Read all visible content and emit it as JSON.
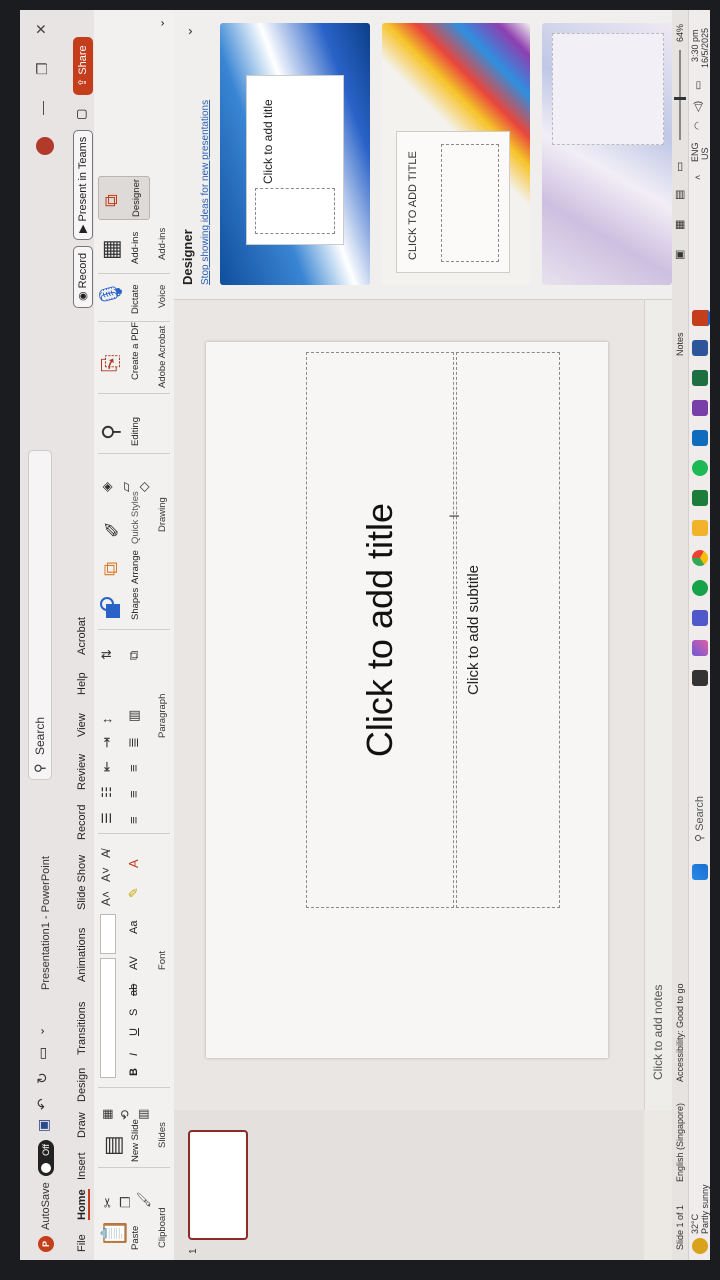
{
  "titlebar": {
    "autosave_label": "AutoSave",
    "autosave_state": "Off",
    "doc_title": "Presentation1 - PowerPoint",
    "search_label": "Search"
  },
  "tabs": [
    "File",
    "Home",
    "Insert",
    "Draw",
    "Design",
    "Transitions",
    "Animations",
    "Slide Show",
    "Record",
    "Review",
    "View",
    "Help",
    "Acrobat"
  ],
  "tab_actions": {
    "record": "Record",
    "present": "Present in Teams",
    "share": "Share"
  },
  "ribbon": {
    "groups": {
      "clipboard": "Clipboard",
      "slides": "Slides",
      "font": "Font",
      "paragraph": "Paragraph",
      "drawing": "Drawing",
      "adobe": "Adobe Acrobat",
      "voice": "Voice",
      "addins": "Add-ins"
    },
    "paste": "Paste",
    "new_slide": "New Slide",
    "shapes": "Shapes",
    "arrange": "Arrange",
    "quick_styles": "Quick Styles",
    "editing": "Editing",
    "create_pdf": "Create a PDF",
    "dictate": "Dictate",
    "addins_btn": "Add-ins",
    "designer_btn": "Designer",
    "font_buttons": [
      "B",
      "I",
      "U",
      "S",
      "ab",
      "AV",
      "Aa"
    ]
  },
  "thumbs": {
    "slide_number": "1"
  },
  "slide": {
    "title_placeholder": "Click to add title",
    "subtitle_placeholder": "Click to add subtitle"
  },
  "notes_placeholder": "Click to add notes",
  "designer": {
    "heading": "Designer",
    "stop_link": "Stop showing ideas for new presentations",
    "card1_text": "Click to add title",
    "card2_text": "CLICK TO ADD TITLE"
  },
  "status": {
    "slide_count": "Slide 1 of 1",
    "language": "English (Singapore)",
    "accessibility": "Accessibility: Good to go",
    "notes": "Notes",
    "zoom": "64%"
  },
  "taskbar": {
    "weather_temp": "32°C",
    "weather_desc": "Partly sunny",
    "search": "Search",
    "lang": "ENG",
    "region": "US",
    "time": "3:30 pm",
    "date": "16/5/2025"
  },
  "colors": {
    "accent": "#c43e1c",
    "link": "#2b5fb3"
  }
}
